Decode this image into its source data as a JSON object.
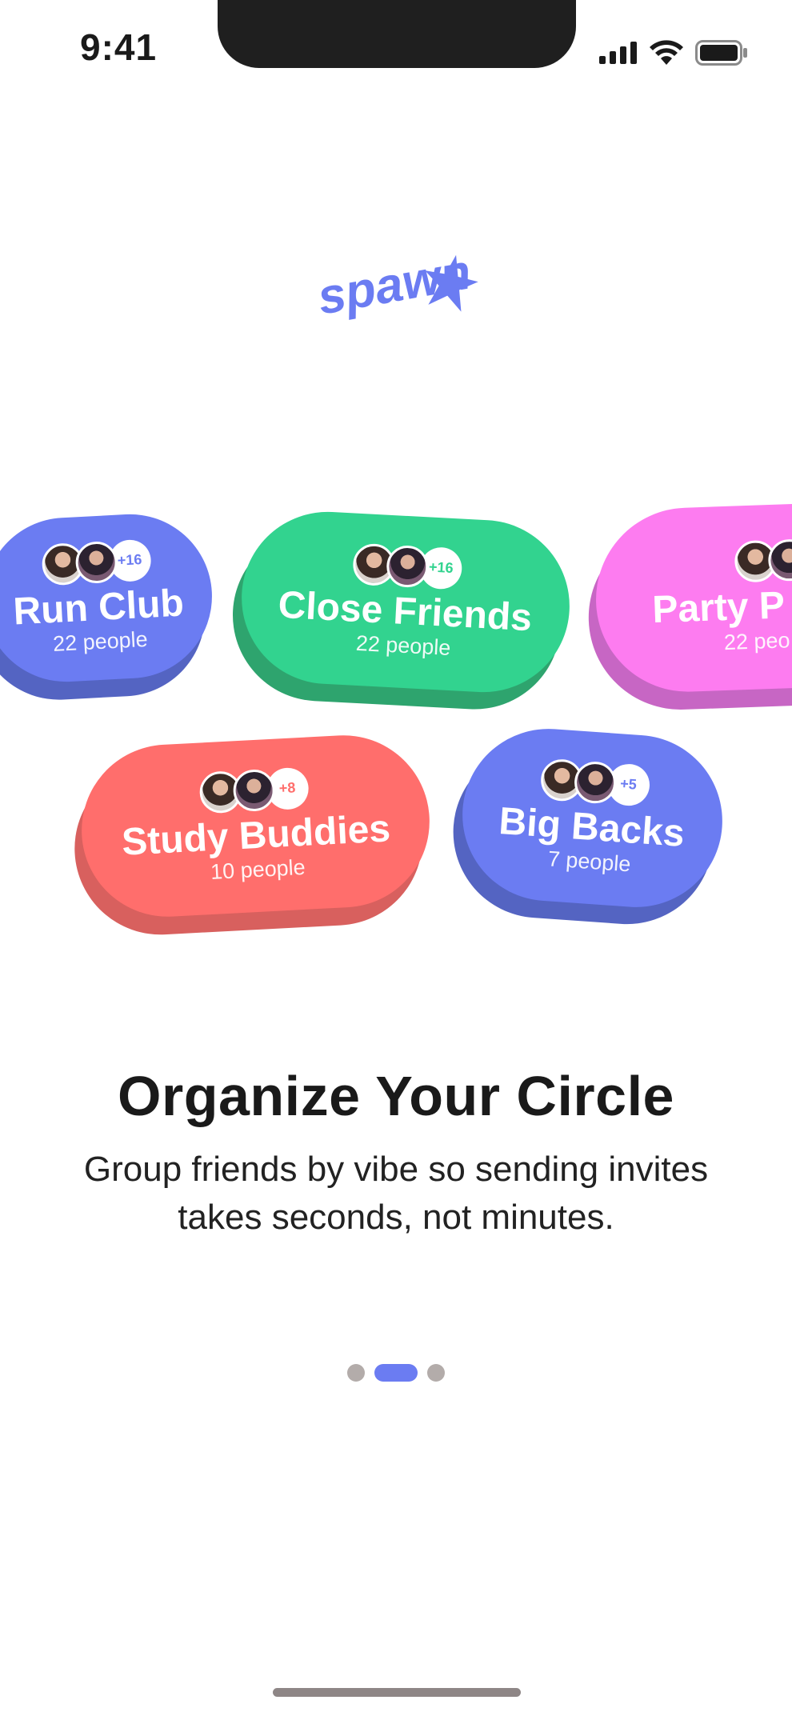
{
  "status_bar": {
    "time": "9:41",
    "icons": [
      "cellular-signal-icon",
      "wifi-icon",
      "battery-icon"
    ]
  },
  "logo": {
    "text": "spawn",
    "icon": "star-icon",
    "color": "#6b7cf2"
  },
  "groups": [
    {
      "name": "Run Club",
      "people": "22 people",
      "extra": "+16",
      "color": "#6b7cf2",
      "shadow": "#5464c2"
    },
    {
      "name": "Close Friends",
      "people": "22 people",
      "extra": "+16",
      "color": "#32d38f",
      "shadow": "#2ea46e"
    },
    {
      "name": "Party P",
      "people": "22 peo",
      "extra": "",
      "color": "#fd7cf0",
      "shadow": "#c766c4"
    },
    {
      "name": "Study Buddies",
      "people": "10 people",
      "extra": "+8",
      "color": "#ff6e6c",
      "shadow": "#d8605e"
    },
    {
      "name": "Big Backs",
      "people": "7 people",
      "extra": "+5",
      "color": "#6b7cf2",
      "shadow": "#5464c2"
    }
  ],
  "onboarding": {
    "title": "Organize Your Circle",
    "subtitle": "Group friends by vibe so sending invites takes seconds, not minutes."
  },
  "pager": {
    "page_index": 2,
    "page_count": 3
  }
}
